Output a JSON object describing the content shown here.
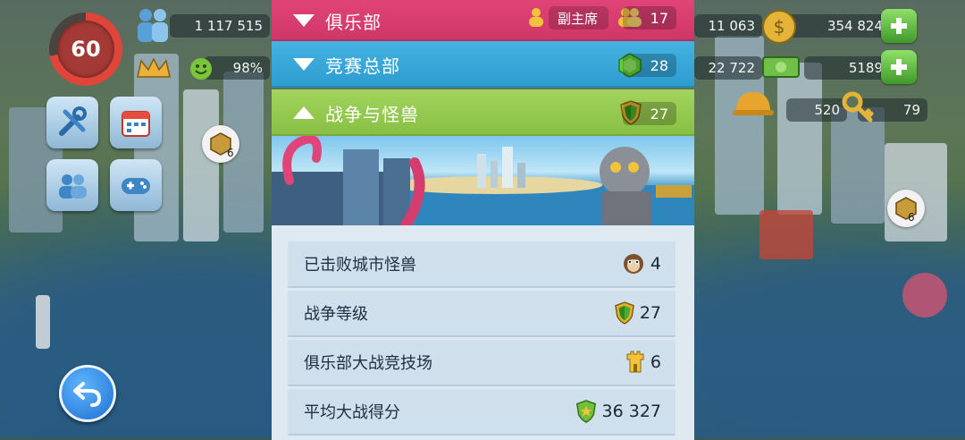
{
  "hud": {
    "level": "60",
    "population": "1 117 515",
    "happiness": "98%",
    "hud_badge_count": "6",
    "resource_left_top": "11 063",
    "resource_left_mid": "22 722",
    "simoleons": "354 824",
    "simcash": "5189",
    "golden_keys_a": "520",
    "golden_keys_b": "79",
    "right_badge_count": "6"
  },
  "panel": {
    "club": {
      "title": "俱乐部",
      "role": "副主席",
      "count": "17"
    },
    "contest": {
      "title": "竞赛总部",
      "count": "28"
    },
    "war": {
      "title": "战争与怪兽",
      "count": "27"
    },
    "stats": [
      {
        "label": "已击败城市怪兽",
        "value": "4",
        "icon": "monster-icon"
      },
      {
        "label": "战争等级",
        "value": "27",
        "icon": "war-shield-icon"
      },
      {
        "label": "俱乐部大战竞技场",
        "value": "6",
        "icon": "arena-tower-icon"
      },
      {
        "label": "平均大战得分",
        "value": "36 327",
        "icon": "score-shield-icon"
      }
    ]
  },
  "colors": {
    "club": "#d63d6f",
    "contest": "#35a5d6",
    "war": "#93c84d"
  }
}
